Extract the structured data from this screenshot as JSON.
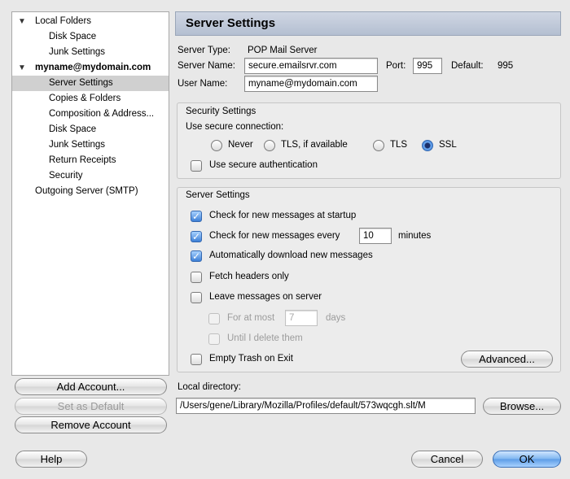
{
  "sidebar": {
    "items": [
      {
        "label": "Local Folders",
        "level": 0,
        "expanded": true,
        "bold": false,
        "selected": false
      },
      {
        "label": "Disk Space",
        "level": 1,
        "bold": false,
        "selected": false
      },
      {
        "label": "Junk Settings",
        "level": 1,
        "bold": false,
        "selected": false
      },
      {
        "label": "myname@mydomain.com",
        "level": 0,
        "expanded": true,
        "bold": true,
        "selected": false
      },
      {
        "label": "Server Settings",
        "level": 1,
        "bold": false,
        "selected": true
      },
      {
        "label": "Copies & Folders",
        "level": 1,
        "bold": false,
        "selected": false
      },
      {
        "label": "Composition & Address...",
        "level": 1,
        "bold": false,
        "selected": false
      },
      {
        "label": "Disk Space",
        "level": 1,
        "bold": false,
        "selected": false
      },
      {
        "label": "Junk Settings",
        "level": 1,
        "bold": false,
        "selected": false
      },
      {
        "label": "Return Receipts",
        "level": 1,
        "bold": false,
        "selected": false
      },
      {
        "label": "Security",
        "level": 1,
        "bold": false,
        "selected": false
      },
      {
        "label": "Outgoing Server (SMTP)",
        "level": 0,
        "bold": false,
        "selected": false
      }
    ],
    "buttons": {
      "add_account": "Add Account...",
      "set_default": "Set as Default",
      "remove_account": "Remove Account"
    }
  },
  "panel": {
    "title": "Server Settings",
    "server_type_label": "Server Type:",
    "server_type_value": "POP Mail Server",
    "server_name_label": "Server Name:",
    "server_name_value": "secure.emailsrvr.com",
    "port_label": "Port:",
    "port_value": "995",
    "default_label": "Default:",
    "default_value": "995",
    "user_name_label": "User Name:",
    "user_name_value": "myname@mydomain.com"
  },
  "security": {
    "legend": "Security Settings",
    "use_secure_label": "Use secure connection:",
    "options": [
      "Never",
      "TLS, if available",
      "TLS",
      "SSL"
    ],
    "selected": "SSL",
    "secure_auth_label": "Use secure authentication",
    "secure_auth_checked": false
  },
  "server": {
    "legend": "Server Settings",
    "check_startup": {
      "label": "Check for new messages at startup",
      "checked": true
    },
    "check_every": {
      "label": "Check for new messages every",
      "value": "10",
      "unit": "minutes",
      "checked": true
    },
    "auto_download": {
      "label": "Automatically download new messages",
      "checked": true
    },
    "fetch_headers": {
      "label": "Fetch headers only",
      "checked": false
    },
    "leave_on_server": {
      "label": "Leave messages on server",
      "checked": false
    },
    "for_at_most": {
      "label": "For at most",
      "value": "7",
      "unit": "days",
      "checked": false
    },
    "until_delete": {
      "label": "Until I delete them",
      "checked": false
    },
    "empty_trash": {
      "label": "Empty Trash on Exit",
      "checked": false
    },
    "advanced_button": "Advanced..."
  },
  "local_dir": {
    "label": "Local directory:",
    "value": "/Users/gene/Library/Mozilla/Profiles/default/573wqcgh.slt/M",
    "browse_button": "Browse..."
  },
  "footer": {
    "help": "Help",
    "cancel": "Cancel",
    "ok": "OK"
  },
  "colors": {
    "accent": "#3d7fd6",
    "header_bg": "#c2cbdb",
    "selection": "#d0d0d0"
  }
}
